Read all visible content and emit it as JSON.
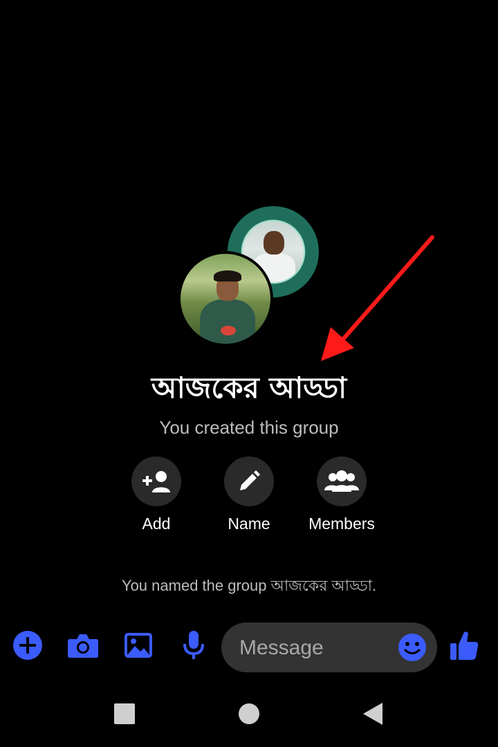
{
  "group": {
    "title": "আজকের আড্ডা",
    "subtitle": "You created this group"
  },
  "actions": [
    {
      "label": "Add",
      "icon": "add-person-icon"
    },
    {
      "label": "Name",
      "icon": "pencil-icon"
    },
    {
      "label": "Members",
      "icon": "people-icon"
    }
  ],
  "system_message": "You named the group আজকের আড্ডা.",
  "composer": {
    "placeholder": "Message",
    "icons": [
      "plus-icon",
      "camera-icon",
      "gallery-icon",
      "mic-icon",
      "emoji-icon",
      "thumbs-up-icon"
    ]
  },
  "nav": {
    "icons": [
      "recents-square-icon",
      "home-circle-icon",
      "back-triangle-icon"
    ]
  },
  "colors": {
    "background": "#000000",
    "accent": "#3b5bfd",
    "button_bg": "#2a2a2a",
    "muted_text": "#bdbdbd",
    "annotation": "#ff1a1a"
  }
}
